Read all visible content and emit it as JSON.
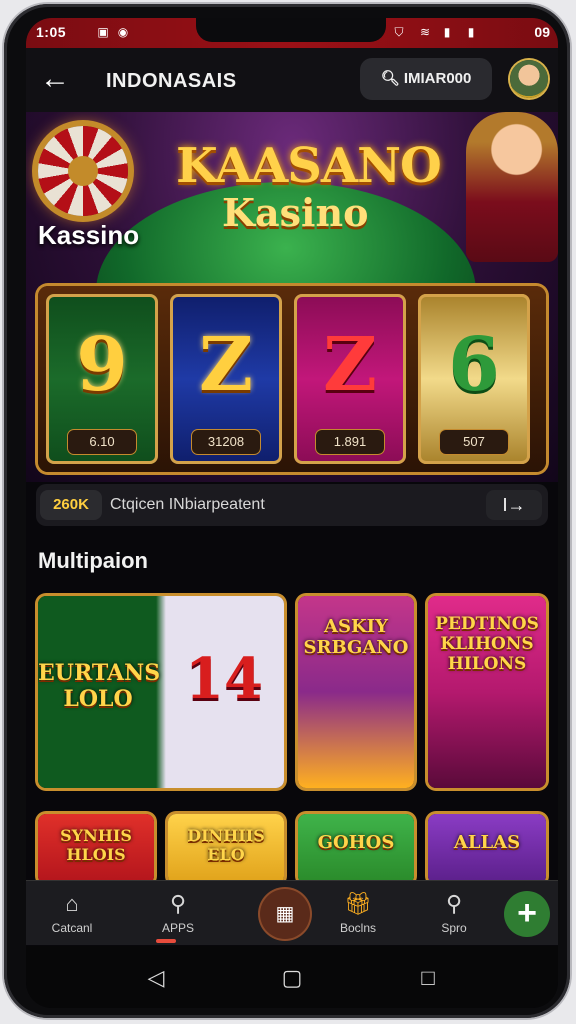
{
  "status": {
    "time": "1:05",
    "right": "09",
    "icons": [
      "sim-icon",
      "alarm-icon",
      "shield-icon",
      "wifi-icon",
      "signal-icon"
    ]
  },
  "topbar": {
    "title": "INDONASAIS",
    "search_text": "IMIAR000"
  },
  "hero": {
    "logo_main": "KAASANO",
    "logo_sub": "Kasino",
    "section_label": "Kassino"
  },
  "reels": [
    {
      "symbol": "9",
      "value": "6.10",
      "color": "#1b6b2a"
    },
    {
      "symbol": "Z",
      "value": "31208",
      "color": "#1f3aa6"
    },
    {
      "symbol": "Z",
      "value": "1.891",
      "color": "#c2177a"
    },
    {
      "symbol": "6",
      "value": "507",
      "color": "#d9b14a"
    }
  ],
  "infobar": {
    "badge": "260K",
    "text": "Ctqicen INbiarpeatent",
    "arrow": "I→"
  },
  "section2": {
    "title": "Multipaion"
  },
  "cards": [
    {
      "text": "EURTANS LOLO",
      "bg": "#1a7a2a"
    },
    {
      "text": "14",
      "bg": "#e6e1ef"
    },
    {
      "text": "ASKIY SRBGANO",
      "bg": "#8a2a8a"
    },
    {
      "text": "PEDTINOS KLIHONS HILONS",
      "bg": "#b4196e"
    },
    {
      "text": "SYNHIS HLOIS",
      "bg": "#b3151c"
    },
    {
      "text": "DINHIIS ELO",
      "bg": "#e0a21a"
    },
    {
      "text": "GOHOS",
      "bg": "#2a8a2a"
    },
    {
      "text": "ALLAS",
      "bg": "#5b1f8a"
    }
  ],
  "bottom_nav": [
    {
      "label": "Catcanl",
      "icon": "home-icon"
    },
    {
      "label": "APPS",
      "icon": "search-icon"
    },
    {
      "label": "",
      "icon": "wallet-icon"
    },
    {
      "label": "Boclns",
      "icon": "gift-icon"
    },
    {
      "label": "Spro",
      "icon": "search-icon"
    },
    {
      "label": "",
      "icon": "plus-icon"
    }
  ],
  "system_nav": [
    "back-icon",
    "home-icon",
    "recents-icon"
  ]
}
